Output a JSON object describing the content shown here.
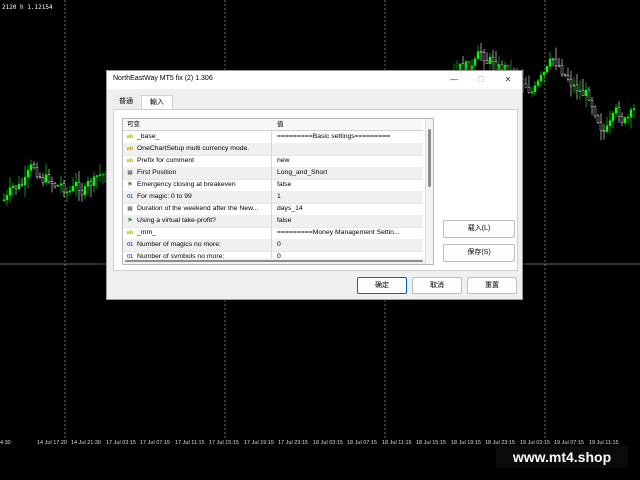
{
  "chart": {
    "price_label": "2120 h 1.12154",
    "time_labels": [
      "4:30",
      "14 Jul 17:20",
      "14 Jul 21:30",
      "17 Jul 03:15",
      "17 Jul 07:15",
      "17 Jul 11:15",
      "17 Jul 15:15",
      "17 Jul 19:15",
      "17 Jul 23:15",
      "18 Jul 03:15",
      "18 Jul 07:15",
      "18 Jul 11:15",
      "18 Jul 15:15",
      "18 Jul 19:15",
      "18 Jul 23:15",
      "19 Jul 03:15",
      "19 Jul 07:15",
      "19 Jul 11:15"
    ],
    "colors": {
      "background": "#000000",
      "bull": "#00ff00",
      "bear": "#ffffff"
    }
  },
  "watermark": "www.mt4.shop",
  "dialog": {
    "title": "NorthEastWay MT5 fix (2) 1.306",
    "window_controls": {
      "minimize": "—",
      "maximize": "☐",
      "close": "✕"
    },
    "tabs": [
      "普通",
      "輸入"
    ],
    "active_tab": "輸入",
    "columns": {
      "name": "可变",
      "value": "值"
    },
    "rows": [
      {
        "icon": "ab",
        "name": "_base_",
        "value": "=========Basic settings========="
      },
      {
        "icon": "ab",
        "name": "OneChartSetup multi currency mode.",
        "value": ""
      },
      {
        "icon": "ab",
        "name": "Prefix for comment",
        "value": "new"
      },
      {
        "icon": "enum",
        "name": "First Position",
        "value": "Long_and_Short"
      },
      {
        "icon": "bool",
        "name": "Emergency closing at breakeven",
        "value": "false"
      },
      {
        "icon": "01",
        "name": "For magic: 0 to 99",
        "value": "1"
      },
      {
        "icon": "enum",
        "name": "Duration of the weekend after the New...",
        "value": "days_14"
      },
      {
        "icon": "bool",
        "name": "Using a virtual take-profit?",
        "value": "false"
      },
      {
        "icon": "ab",
        "name": "_mm_",
        "value": "=========Money Management Settin..."
      },
      {
        "icon": "01",
        "name": "Number of magics no more:",
        "value": "0"
      },
      {
        "icon": "01",
        "name": "Number of symbols no more:",
        "value": "0"
      }
    ],
    "side_buttons": {
      "load": "载入(L)",
      "save": "保存(S)"
    },
    "bottom_buttons": {
      "ok": "确定",
      "cancel": "取消",
      "reset": "重置"
    }
  }
}
